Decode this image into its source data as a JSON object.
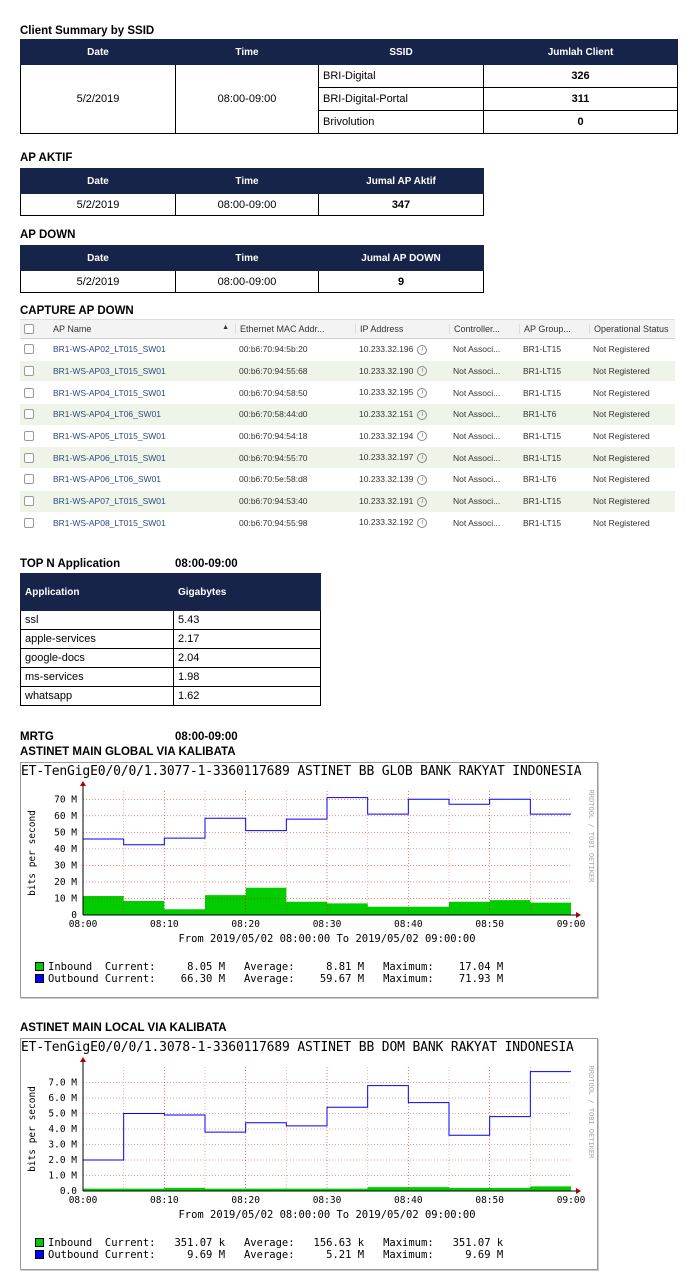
{
  "client_summary": {
    "title": "Client Summary by SSID",
    "headers": [
      "Date",
      "Time",
      "SSID",
      "Jumlah Client"
    ],
    "date": "5/2/2019",
    "time": "08:00-09:00",
    "rows": [
      {
        "ssid": "BRI-Digital",
        "count": "326"
      },
      {
        "ssid": "BRI-Digital-Portal",
        "count": "311"
      },
      {
        "ssid": "Brivolution",
        "count": "0"
      }
    ]
  },
  "ap_aktif": {
    "title": "AP AKTIF",
    "headers": [
      "Date",
      "Time",
      "Jumal AP Aktif"
    ],
    "date": "5/2/2019",
    "time": "08:00-09:00",
    "value": "347"
  },
  "ap_down": {
    "title": "AP DOWN",
    "headers": [
      "Date",
      "Time",
      "Jumal AP DOWN"
    ],
    "date": "5/2/2019",
    "time": "08:00-09:00",
    "value": "9"
  },
  "capture": {
    "title": "CAPTURE AP DOWN",
    "headers": [
      "AP Name",
      "Ethernet MAC Addr...",
      "IP Address",
      "Controller...",
      "AP Group...",
      "Operational Status"
    ],
    "rows": [
      {
        "name": "BR1-WS-AP02_LT015_SW01",
        "mac": "00:b6:70:94:5b:20",
        "ip": "10.233.32.196",
        "ctrl": "Not Associ...",
        "group": "BR1-LT15",
        "status": "Not Registered"
      },
      {
        "name": "BR1-WS-AP03_LT015_SW01",
        "mac": "00:b6:70:94:55:68",
        "ip": "10.233.32.190",
        "ctrl": "Not Associ...",
        "group": "BR1-LT15",
        "status": "Not Registered"
      },
      {
        "name": "BR1-WS-AP04_LT015_SW01",
        "mac": "00:b6:70:94:58:50",
        "ip": "10.233.32.195",
        "ctrl": "Not Associ...",
        "group": "BR1-LT15",
        "status": "Not Registered"
      },
      {
        "name": "BR1-WS-AP04_LT06_SW01",
        "mac": "00:b6:70:58:44:d0",
        "ip": "10.233.32.151",
        "ctrl": "Not Associ...",
        "group": "BR1-LT6",
        "status": "Not Registered"
      },
      {
        "name": "BR1-WS-AP05_LT015_SW01",
        "mac": "00:b6:70:94:54:18",
        "ip": "10.233.32.194",
        "ctrl": "Not Associ...",
        "group": "BR1-LT15",
        "status": "Not Registered"
      },
      {
        "name": "BR1-WS-AP06_LT015_SW01",
        "mac": "00:b6:70:94:55:70",
        "ip": "10.233.32.197",
        "ctrl": "Not Associ...",
        "group": "BR1-LT15",
        "status": "Not Registered"
      },
      {
        "name": "BR1-WS-AP06_LT06_SW01",
        "mac": "00:b6:70:5e:58:d8",
        "ip": "10.233.32.139",
        "ctrl": "Not Associ...",
        "group": "BR1-LT6",
        "status": "Not Registered"
      },
      {
        "name": "BR1-WS-AP07_LT015_SW01",
        "mac": "00:b6:70:94:53:40",
        "ip": "10.233.32.191",
        "ctrl": "Not Associ...",
        "group": "BR1-LT15",
        "status": "Not Registered"
      },
      {
        "name": "BR1-WS-AP08_LT015_SW01",
        "mac": "00:b6:70:94:55:98",
        "ip": "10.233.32.192",
        "ctrl": "Not Associ...",
        "group": "BR1-LT15",
        "status": "Not Registered"
      }
    ]
  },
  "top_n": {
    "title": "TOP N Application",
    "time": "08:00-09:00",
    "headers": [
      "Application",
      "Gigabytes"
    ],
    "rows": [
      {
        "app": "ssl",
        "gb": "5.43"
      },
      {
        "app": "apple-services",
        "gb": "2.17"
      },
      {
        "app": "google-docs",
        "gb": "2.04"
      },
      {
        "app": "ms-services",
        "gb": "1.98"
      },
      {
        "app": "whatsapp",
        "gb": "1.62"
      }
    ]
  },
  "mrtg": {
    "label": "MRTG",
    "time": "08:00-09:00",
    "colors": {
      "inbound": "#00cc00",
      "outbound": "#0000ff",
      "grid": "#ff0000",
      "axis": "#000000"
    }
  },
  "chart_data": [
    {
      "type": "area",
      "section_title": "ASTINET MAIN GLOBAL VIA KALIBATA",
      "title": "ET-TenGigE0/0/0/1.3077-1-3360117689 ASTINET BB GLOB BANK RAKYAT INDONESIA",
      "watermark": "RRDTOOL / TOBI OETIKER",
      "ylabel": "bits per second",
      "xlabel": "From 2019/05/02 08:00:00 To 2019/05/02 09:00:00",
      "x_ticks": [
        "08:00",
        "08:10",
        "08:20",
        "08:30",
        "08:40",
        "08:50",
        "09:00"
      ],
      "y_ticks": [
        "0",
        "10 M",
        "20 M",
        "30 M",
        "40 M",
        "50 M",
        "60 M",
        "70 M"
      ],
      "ylim": [
        0,
        75
      ],
      "xlim": [
        0,
        60
      ],
      "y_unit": "M bits/s",
      "series": [
        {
          "name": "Inbound",
          "kind": "area",
          "steps": [
            [
              0,
              11.5
            ],
            [
              5,
              8.5
            ],
            [
              10,
              3.5
            ],
            [
              15,
              12
            ],
            [
              20,
              16.5
            ],
            [
              25,
              8
            ],
            [
              30,
              7
            ],
            [
              35,
              5
            ],
            [
              45,
              8
            ],
            [
              50,
              9
            ],
            [
              55,
              7.5
            ],
            [
              60,
              7.5
            ]
          ]
        },
        {
          "name": "Outbound",
          "kind": "line",
          "steps": [
            [
              0,
              46
            ],
            [
              5,
              42.5
            ],
            [
              10,
              46.5
            ],
            [
              15,
              58.5
            ],
            [
              20,
              51
            ],
            [
              25,
              58
            ],
            [
              30,
              71
            ],
            [
              35,
              61
            ],
            [
              40,
              70
            ],
            [
              45,
              67
            ],
            [
              50,
              70
            ],
            [
              55,
              61
            ],
            [
              60,
              61
            ]
          ]
        }
      ],
      "legend": [
        {
          "name": "Inbound",
          "current": "8.05 M",
          "average": "8.81 M",
          "maximum": "17.04 M"
        },
        {
          "name": "Outbound",
          "current": "66.30 M",
          "average": "59.67 M",
          "maximum": "71.93 M"
        }
      ]
    },
    {
      "type": "area",
      "section_title": "ASTINET MAIN LOCAL VIA KALIBATA",
      "title": "ET-TenGigE0/0/0/1.3078-1-3360117689 ASTINET BB DOM BANK RAKYAT INDONESIA",
      "watermark": "RRDTOOL / TOBI OETIKER",
      "ylabel": "bits per second",
      "xlabel": "From 2019/05/02 08:00:00 To 2019/05/02 09:00:00",
      "x_ticks": [
        "08:00",
        "08:10",
        "08:20",
        "08:30",
        "08:40",
        "08:50",
        "09:00"
      ],
      "y_ticks": [
        "0.0",
        "1.0 M",
        "2.0 M",
        "3.0 M",
        "4.0 M",
        "5.0 M",
        "6.0 M",
        "7.0 M"
      ],
      "ylim": [
        0,
        8
      ],
      "xlim": [
        0,
        60
      ],
      "y_unit": "M bits/s",
      "series": [
        {
          "name": "Inbound",
          "kind": "area",
          "steps": [
            [
              0,
              0.15
            ],
            [
              10,
              0.2
            ],
            [
              15,
              0.15
            ],
            [
              35,
              0.25
            ],
            [
              45,
              0.2
            ],
            [
              55,
              0.3
            ],
            [
              60,
              0.3
            ]
          ]
        },
        {
          "name": "Outbound",
          "kind": "line",
          "steps": [
            [
              0,
              2.0
            ],
            [
              5,
              5.0
            ],
            [
              10,
              4.9
            ],
            [
              15,
              3.8
            ],
            [
              20,
              4.4
            ],
            [
              25,
              4.2
            ],
            [
              30,
              5.4
            ],
            [
              35,
              6.8
            ],
            [
              40,
              5.7
            ],
            [
              45,
              3.6
            ],
            [
              50,
              4.8
            ],
            [
              55,
              7.7
            ],
            [
              60,
              7.7
            ]
          ]
        }
      ],
      "legend": [
        {
          "name": "Inbound",
          "current": "351.07 k",
          "average": "156.63 k",
          "maximum": "351.07 k"
        },
        {
          "name": "Outbound",
          "current": "9.69 M",
          "average": "5.21 M",
          "maximum": "9.69 M"
        }
      ]
    }
  ]
}
